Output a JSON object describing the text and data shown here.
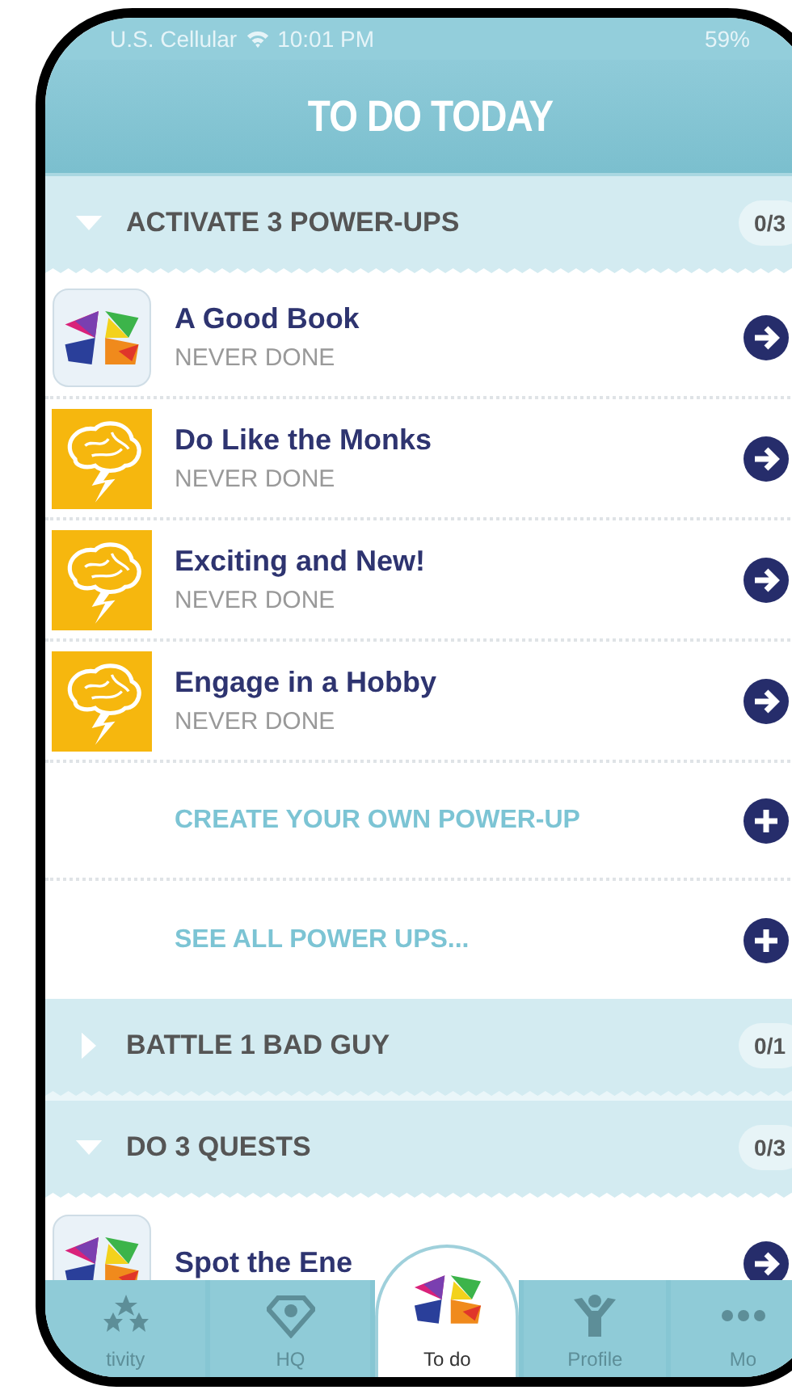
{
  "status_bar": {
    "carrier": "U.S. Cellular",
    "time": "10:01 PM",
    "battery": "59%"
  },
  "title": "TO DO TODAY",
  "sections": [
    {
      "title": "ACTIVATE 3 POWER-UPS",
      "count": "0/3",
      "expanded": true,
      "items": [
        {
          "kind": "logo",
          "title": "A Good Book",
          "status": "NEVER DONE"
        },
        {
          "kind": "brain",
          "title": "Do Like the Monks",
          "status": "NEVER DONE"
        },
        {
          "kind": "brain",
          "title": "Exciting and New!",
          "status": "NEVER DONE"
        },
        {
          "kind": "brain",
          "title": "Engage in a Hobby",
          "status": "NEVER DONE"
        },
        {
          "kind": "action",
          "title": "CREATE YOUR OWN POWER-UP"
        },
        {
          "kind": "action",
          "title": "SEE ALL POWER UPS..."
        }
      ]
    },
    {
      "title": "BATTLE 1 BAD GUY",
      "count": "0/1",
      "expanded": false
    },
    {
      "title": "DO 3 QUESTS",
      "count": "0/3",
      "expanded": true,
      "items": [
        {
          "kind": "logo",
          "title": "Spot the Ene"
        }
      ]
    }
  ],
  "tabs": [
    {
      "kind": "activity",
      "label": "tivity",
      "selected": false
    },
    {
      "kind": "hq",
      "label": "HQ",
      "selected": false
    },
    {
      "kind": "todo",
      "label": "To do",
      "selected": true
    },
    {
      "kind": "profile",
      "label": "Profile",
      "selected": false
    },
    {
      "kind": "more",
      "label": "Mo",
      "selected": false
    }
  ]
}
